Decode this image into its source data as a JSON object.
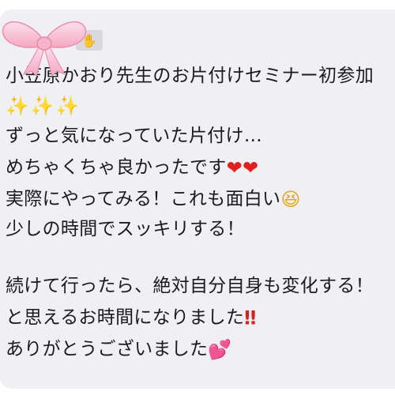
{
  "message": {
    "lines": [
      "小笠原かおり先生のお片付けセミナー初参加",
      "✨✨✨",
      "ずっと気になっていた片付け…",
      "めちゃくちゃ良かったです",
      "実際にやってみる！これも面白い",
      "少しの時間でスッキリする！",
      "続けて行ったら、絶対自分自身も変化する！",
      "と思えるお時間になりました",
      "ありがとうございました"
    ],
    "emojis": {
      "hearts": "❤❤",
      "grin": "😆",
      "double_exclamation": "‼",
      "pink_hearts": "💕"
    }
  },
  "decor": {
    "ribbon": "pink-bow",
    "hand": "raised-hand-icon"
  },
  "colors": {
    "bubble_bg": "#efeff4",
    "text": "#1b1b1f",
    "ribbon_pink": "#f6b9cc",
    "heart_red": "#e0211f",
    "sparkle_gold": "#f3c530"
  }
}
